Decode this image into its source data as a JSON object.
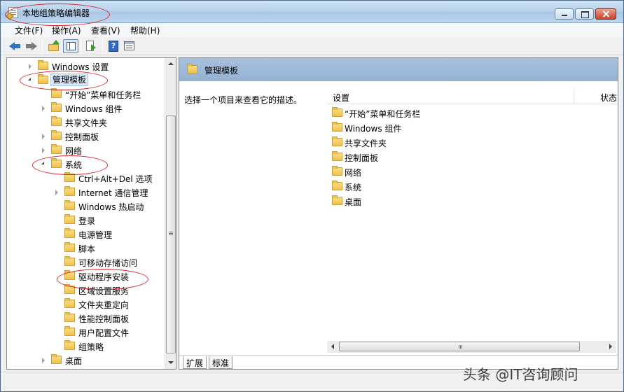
{
  "window": {
    "title": "本地组策略编辑器"
  },
  "menu": [
    "文件(F)",
    "操作(A)",
    "查看(V)",
    "帮助(H)"
  ],
  "toolbar": {
    "buttons": [
      "back-arrow-icon",
      "forward-arrow-icon",
      "up-folder-icon",
      "show-tree-icon",
      "export-list-icon",
      "help-icon",
      "properties-icon"
    ]
  },
  "tree": {
    "items": [
      {
        "label": "Windows 设置",
        "level": 0,
        "expander": "collapsed"
      },
      {
        "label": "管理模板",
        "level": 0,
        "expander": "expanded",
        "selected": true
      },
      {
        "label": "“开始”菜单和任务栏",
        "level": 1,
        "expander": "none"
      },
      {
        "label": "Windows 组件",
        "level": 1,
        "expander": "collapsed"
      },
      {
        "label": "共享文件夹",
        "level": 1,
        "expander": "none"
      },
      {
        "label": "控制面板",
        "level": 1,
        "expander": "collapsed"
      },
      {
        "label": "网络",
        "level": 1,
        "expander": "collapsed"
      },
      {
        "label": "系统",
        "level": 1,
        "expander": "expanded"
      },
      {
        "label": "Ctrl+Alt+Del 选项",
        "level": 2,
        "expander": "none"
      },
      {
        "label": "Internet 通信管理",
        "level": 2,
        "expander": "collapsed"
      },
      {
        "label": "Windows 热启动",
        "level": 2,
        "expander": "none"
      },
      {
        "label": "登录",
        "level": 2,
        "expander": "none"
      },
      {
        "label": "电源管理",
        "level": 2,
        "expander": "none"
      },
      {
        "label": "脚本",
        "level": 2,
        "expander": "none"
      },
      {
        "label": "可移动存储访问",
        "level": 2,
        "expander": "none"
      },
      {
        "label": "驱动程序安装",
        "level": 2,
        "expander": "none"
      },
      {
        "label": "区域设置服务",
        "level": 2,
        "expander": "none"
      },
      {
        "label": "文件夹重定向",
        "level": 2,
        "expander": "none"
      },
      {
        "label": "性能控制面板",
        "level": 2,
        "expander": "none"
      },
      {
        "label": "用户配置文件",
        "level": 2,
        "expander": "none"
      },
      {
        "label": "组策略",
        "level": 2,
        "expander": "none"
      },
      {
        "label": "桌面",
        "level": 1,
        "expander": "collapsed"
      }
    ]
  },
  "right": {
    "title": "管理模板",
    "description": "选择一个项目来查看它的描述。",
    "columns": {
      "setting": "设置",
      "status": "状态"
    },
    "items": [
      "“开始”菜单和任务栏",
      "Windows 组件",
      "共享文件夹",
      "控制面板",
      "网络",
      "系统",
      "桌面"
    ]
  },
  "tabs": [
    "扩展",
    "标准"
  ],
  "watermark": "头条 @IT咨询顾问"
}
